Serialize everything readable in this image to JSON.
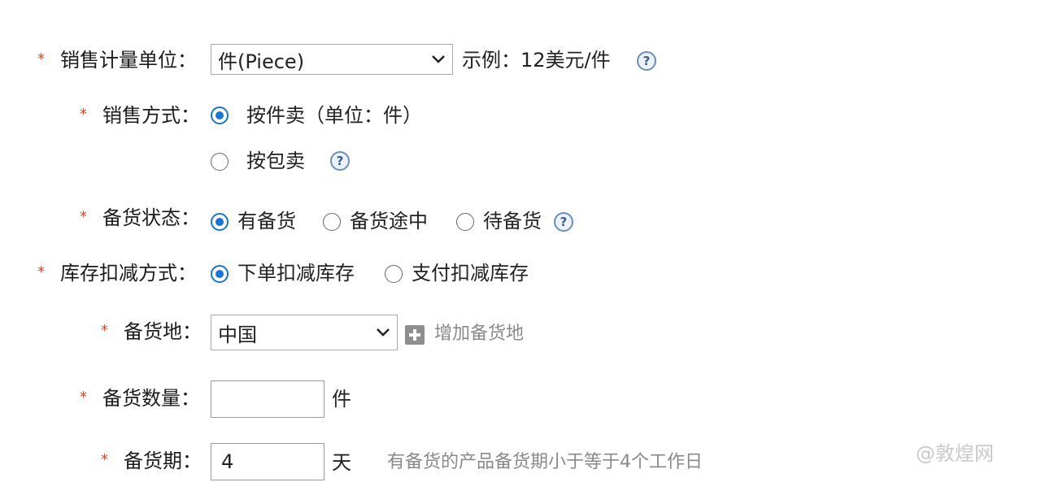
{
  "form": {
    "unit": {
      "label": "销售计量单位：",
      "select_value": "件(Piece)",
      "example": "示例：12美元/件"
    },
    "sale_method": {
      "label": "销售方式：",
      "options": [
        "按件卖（单位：件）",
        "按包卖"
      ],
      "selected": 0
    },
    "stock_status": {
      "label": "备货状态：",
      "options": [
        "有备货",
        "备货途中",
        "待备货"
      ],
      "selected": 0
    },
    "inventory_deduct": {
      "label": "库存扣减方式：",
      "options": [
        "下单扣减库存",
        "支付扣减库存"
      ],
      "selected": 0
    },
    "stock_location": {
      "label": "备货地：",
      "select_value": "中国",
      "add_label": "增加备货地"
    },
    "stock_quantity": {
      "label": "备货数量：",
      "value": "",
      "unit": "件"
    },
    "stock_period": {
      "label": "备货期：",
      "value": "4",
      "unit": "天",
      "hint": "有备货的产品备货期小于等于4个工作日"
    },
    "required_mark": "*",
    "help_glyph": "?"
  },
  "watermark": {
    "text": "@敦煌网"
  },
  "colors": {
    "required": "#e04a2f",
    "radio_selected": "#1a73d9",
    "help_border": "#6b8fb8",
    "hint_text": "#8a8a8a"
  },
  "icons": {
    "dropdown": "chevron-down-icon",
    "help": "help-icon",
    "add": "plus-square-icon"
  }
}
